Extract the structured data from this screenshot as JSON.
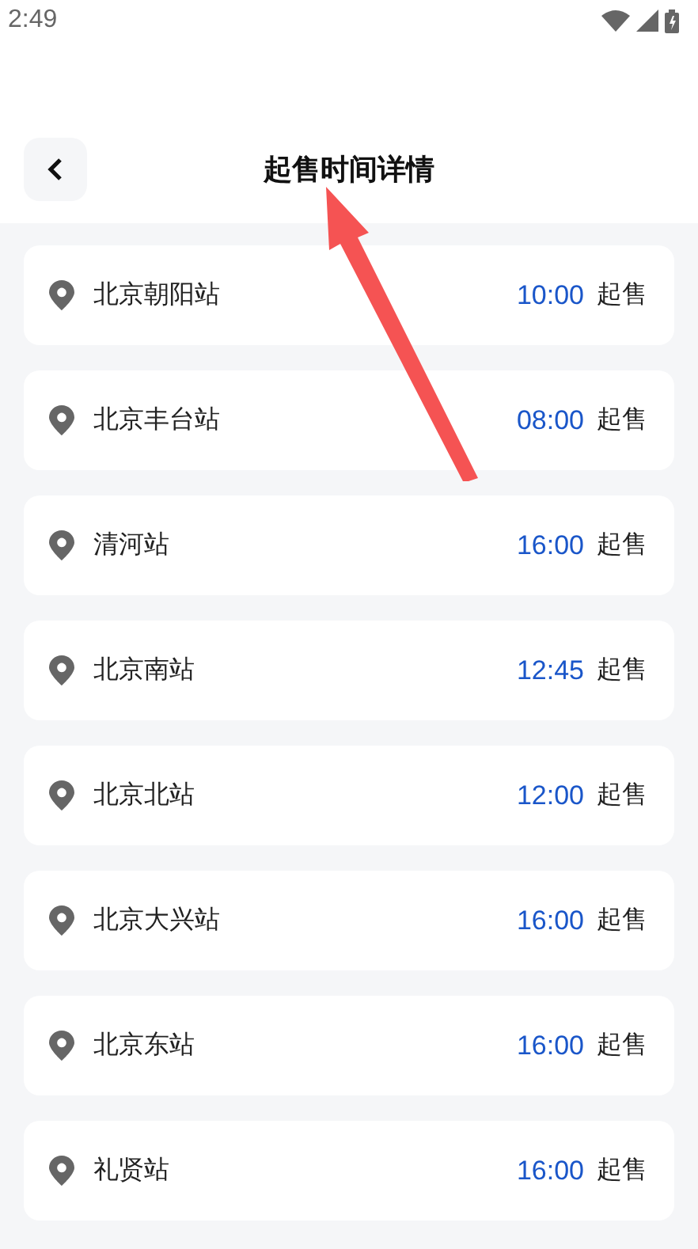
{
  "status_bar": {
    "time": "2:49"
  },
  "header": {
    "title": "起售时间详情"
  },
  "stations": [
    {
      "name": "北京朝阳站",
      "time": "10:00",
      "suffix": "起售"
    },
    {
      "name": "北京丰台站",
      "time": "08:00",
      "suffix": "起售"
    },
    {
      "name": "清河站",
      "time": "16:00",
      "suffix": "起售"
    },
    {
      "name": "北京南站",
      "time": "12:45",
      "suffix": "起售"
    },
    {
      "name": "北京北站",
      "time": "12:00",
      "suffix": "起售"
    },
    {
      "name": "北京大兴站",
      "time": "16:00",
      "suffix": "起售"
    },
    {
      "name": "北京东站",
      "time": "16:00",
      "suffix": "起售"
    },
    {
      "name": "礼贤站",
      "time": "16:00",
      "suffix": "起售"
    }
  ]
}
